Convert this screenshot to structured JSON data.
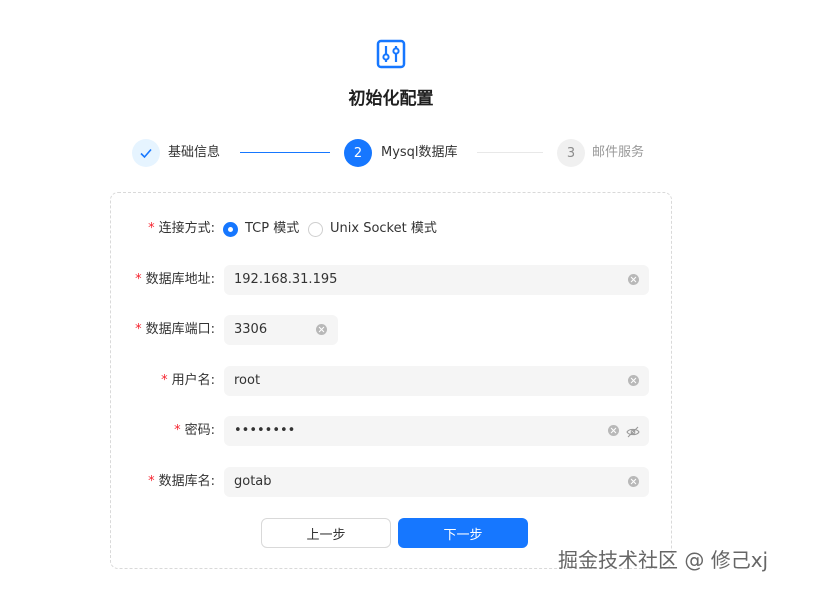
{
  "page": {
    "title": "初始化配置"
  },
  "steps": [
    {
      "label": "基础信息",
      "status": "done",
      "icon": "check-icon"
    },
    {
      "number": "2",
      "label": "Mysql数据库",
      "status": "active"
    },
    {
      "number": "3",
      "label": "邮件服务",
      "status": "pending"
    }
  ],
  "form": {
    "connection": {
      "label": "连接方式:",
      "options": [
        {
          "label": "TCP 模式",
          "selected": true
        },
        {
          "label": "Unix Socket 模式",
          "selected": false
        }
      ]
    },
    "host": {
      "label": "数据库地址:",
      "value": "192.168.31.195"
    },
    "port": {
      "label": "数据库端口:",
      "value": "3306"
    },
    "username": {
      "label": "用户名:",
      "value": "root"
    },
    "password": {
      "label": "密码:",
      "value": "••••••••"
    },
    "database": {
      "label": "数据库名:",
      "value": "gotab"
    }
  },
  "buttons": {
    "prev": "上一步",
    "next": "下一步"
  },
  "watermark": "掘金技术社区 @ 修己xj",
  "colors": {
    "primary": "#1677ff",
    "required": "#f5222d",
    "input_bg": "#f5f5f5"
  }
}
